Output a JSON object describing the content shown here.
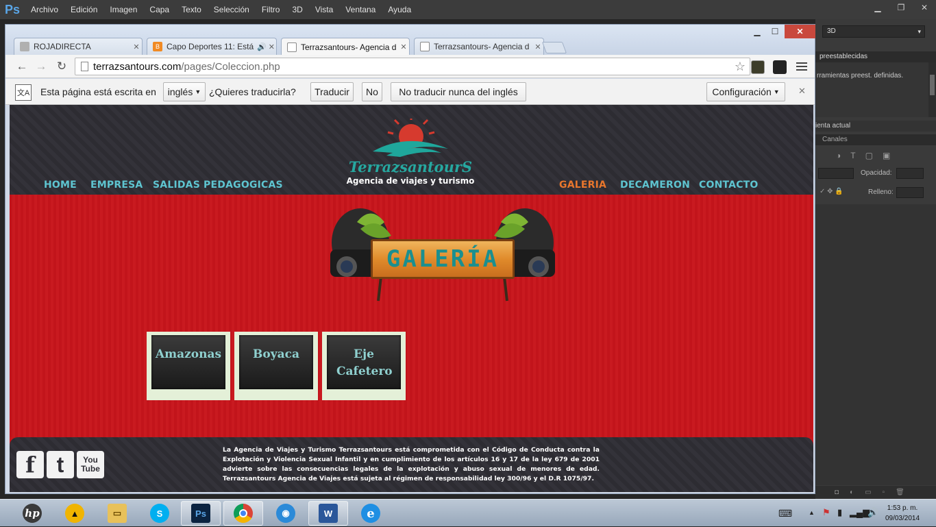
{
  "photoshop": {
    "logo": "Ps",
    "menu": [
      "Archivo",
      "Edición",
      "Imagen",
      "Capa",
      "Texto",
      "Selección",
      "Filtro",
      "3D",
      "Vista",
      "Ventana",
      "Ayuda"
    ],
    "workspace_dropdown": "3D",
    "panel_tab": "preestablecidas",
    "panel_text": "rramientas preest. definidas.",
    "current_tool_label": "ienta actual",
    "channels_tab": "Canales",
    "opacity_label": "Opacidad:",
    "fill_label": "Relleno:"
  },
  "browser": {
    "tabs": [
      {
        "title": "ROJADIRECTA",
        "favicon_color": "#b0b0b0"
      },
      {
        "title": "Capo Deportes 11: Está",
        "favicon_color": "#f08a24"
      },
      {
        "title": "Terrazsantours- Agencia d",
        "favicon_color": "#ffffff"
      },
      {
        "title": "Terrazsantours- Agencia d",
        "favicon_color": "#ffffff"
      }
    ],
    "url_host": "terrazsantours.com",
    "url_path": "/pages/Coleccion.php",
    "translate_bar": {
      "prefix": "Esta página está escrita en",
      "language": "inglés",
      "question": "¿Quieres traducirla?",
      "translate_button": "Traducir",
      "no_button": "No",
      "never_button": "No traducir nunca del inglés",
      "settings_button": "Configuración"
    }
  },
  "site": {
    "nav_left": [
      "HOME",
      "EMPRESA",
      "SALIDAS PEDAGOGICAS"
    ],
    "nav_right": [
      "GALERIA",
      "DECAMERON",
      "CONTACTO"
    ],
    "active_nav": "GALERIA",
    "logo_name": "TerrazsantourS",
    "logo_tagline": "Agencia de viajes y turismo",
    "banner_title": "GALERÍA",
    "gallery": [
      "Amazonas",
      "Boyaca",
      "Eje Cafetero"
    ],
    "social": [
      "f",
      "t",
      "You Tube"
    ],
    "footer_text": "La Agencia de Viajes y Turismo Terrazsantours está comprometida con el Código de Conducta contra la Explotación y Violencia Sexual Infantil y en cumplimiento de los artículos 16 y 17 de la ley 679 de 2001 advierte sobre las consecuencias legales de la explotación y abuso sexual de menores de edad. Terrazsantours Agencia de Viajes está sujeta al régimen de responsabilidad ley 300/96 y el D.R 1075/97.",
    "colors": {
      "nav": "#5ec4d0",
      "nav_active": "#e8762c",
      "body_red": "#c8151c",
      "header_dark": "#2f2e35"
    }
  },
  "taskbar": {
    "time": "1:53 p. m.",
    "date": "09/03/2014"
  }
}
